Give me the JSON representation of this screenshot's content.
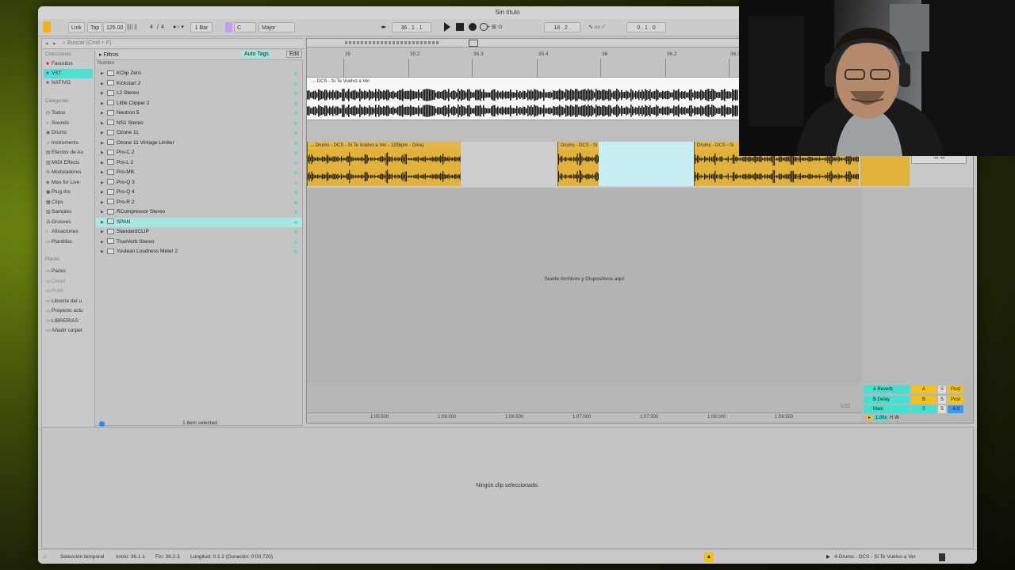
{
  "window": {
    "title": "Sin título"
  },
  "transport": {
    "link": "Link",
    "tap": "Tap",
    "tempo": "125.00",
    "signature_num": "4",
    "signature_den": "4",
    "quant": "1 Bar",
    "key": "C",
    "scale": "Major",
    "position": "36 .  1 .  1",
    "loop_start": "18 .  2 .",
    "loop_len": "0 .  1 .  0"
  },
  "browser": {
    "search_placeholder": "Buscar (Cmd + F)",
    "collections_header": "Colecciones",
    "collections": [
      "Favoritos",
      "VST",
      "NATIVO"
    ],
    "categories_header": "Categorías",
    "categories": [
      "Todos",
      "Sounds",
      "Drums",
      "Instruments",
      "Efectos de Au",
      "MIDI Effects",
      "Moduladores",
      "Max for Live",
      "Plug-Ins",
      "Clips",
      "Samples",
      "Grooves",
      "Afinaciones",
      "Plantillas"
    ],
    "places_header": "Places",
    "places": [
      "Packs",
      "Cloud",
      "Push",
      "Librería del u",
      "Proyecto actu",
      "LIBRERIAS",
      "Añadir carpet"
    ],
    "filters_label": "Filtros",
    "auto_tags": "Auto Tags",
    "edit": "Edit",
    "column_name": "Nombre",
    "items": [
      "KClip Zero",
      "Kickstart 2",
      "L2 Stereo",
      "Little Clipper 2",
      "Neutron 5",
      "NS1 Stereo",
      "Ozone 11",
      "Ozone 11 Vintage Limiter",
      "Pro-C 2",
      "Pro-L 2",
      "Pro-MB",
      "Pro-Q 3",
      "Pro-Q 4",
      "Pro-R 2",
      "RCompressor Stereo",
      "SPAN",
      "StandardCLIP",
      "TrueVerb Stereo",
      "Youlean Loudness Meter 2"
    ],
    "selected_item": "SPAN",
    "footer": "1 item selected"
  },
  "arrangement": {
    "ruler": [
      "35",
      "35.2",
      "35.3",
      "35.4",
      "36",
      "36.2",
      "36.3"
    ],
    "track1_clip": "... DCS - Si Te Vuelvo a Ver",
    "track2_clips": [
      "... Drums - DCS - Si Te Vuelvo a Ver - 125bpm - Gmaj",
      "Drums - DCS - Si",
      "Drums - DCS - Si"
    ],
    "drop_hint": "Suelte Archivos y Dispositivos aquí",
    "timeline": [
      "1:05:500",
      "1:06:000",
      "1:06:500",
      "1:07:000",
      "1:07:500",
      "1:08:000",
      "1:08:500"
    ],
    "grid": "1/32",
    "returns": [
      {
        "name": "A Reverb",
        "letter": "A",
        "s": "S",
        "post": "Post"
      },
      {
        "name": "B Delay",
        "letter": "B",
        "s": "S",
        "post": "Post"
      },
      {
        "name": "Main",
        "letter": "0",
        "s": "S",
        "post": "-6.0"
      }
    ],
    "zoom": "1.00x",
    "h": "H",
    "w": "W"
  },
  "detail": {
    "empty": "Ningún clip seleccionado."
  },
  "status": {
    "mode": "Selección temporal",
    "start": "Inicio: 36.1.1",
    "end": "Fin: 36.2.3",
    "length": "Longitud: 0.1.2  (Duración: 0:00:720)",
    "track": "4-Drums - DCS - Si Te Vuelvo a Ver"
  },
  "colors": {
    "clip": "#e2b13b",
    "selection": "#c6eef2",
    "accent": "#43e0d2",
    "yellow": "#f2c21a"
  }
}
